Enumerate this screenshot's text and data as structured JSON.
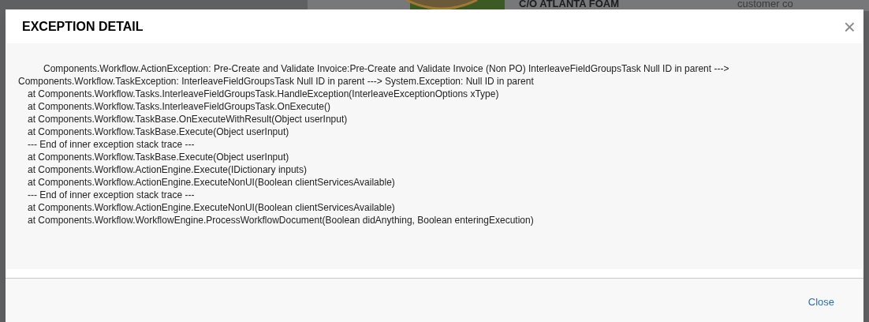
{
  "background": {
    "company_line": "C/O ATLANTA FOAM",
    "heading": "customer co"
  },
  "dialog": {
    "title": "EXCEPTION DETAIL",
    "close_glyph": "×",
    "lines": [
      {
        "kind": "lead",
        "text": "Components.Workflow.ActionException: Pre-Create and Validate Invoice:Pre-Create and Validate Invoice (Non PO) InterleaveFieldGroupsTask Null ID in parent --->"
      },
      {
        "kind": "wrap",
        "text": "Components.Workflow.TaskException: InterleaveFieldGroupsTask Null ID in parent ---> System.Exception: Null ID in parent"
      },
      {
        "kind": "frame",
        "text": "at Components.Workflow.Tasks.InterleaveFieldGroupsTask.HandleException(InterleaveExceptionOptions xType)"
      },
      {
        "kind": "frame",
        "text": "at Components.Workflow.Tasks.InterleaveFieldGroupsTask.OnExecute()"
      },
      {
        "kind": "frame",
        "text": "at Components.Workflow.TaskBase.OnExecuteWithResult(Object userInput)"
      },
      {
        "kind": "frame",
        "text": "at Components.Workflow.TaskBase.Execute(Object userInput)"
      },
      {
        "kind": "frame",
        "text": "--- End of inner exception stack trace ---"
      },
      {
        "kind": "frame",
        "text": "at Components.Workflow.TaskBase.Execute(Object userInput)"
      },
      {
        "kind": "frame",
        "text": "at Components.Workflow.ActionEngine.Execute(IDictionary inputs)"
      },
      {
        "kind": "frame",
        "text": "at Components.Workflow.ActionEngine.ExecuteNonUI(Boolean clientServicesAvailable)"
      },
      {
        "kind": "frame",
        "text": "--- End of inner exception stack trace ---"
      },
      {
        "kind": "frame",
        "text": "at Components.Workflow.ActionEngine.ExecuteNonUI(Boolean clientServicesAvailable)"
      },
      {
        "kind": "frame",
        "text": "at Components.Workflow.WorkflowEngine.ProcessWorkflowDocument(Boolean didAnything, Boolean enteringExecution)"
      }
    ],
    "close_label": "Close"
  }
}
